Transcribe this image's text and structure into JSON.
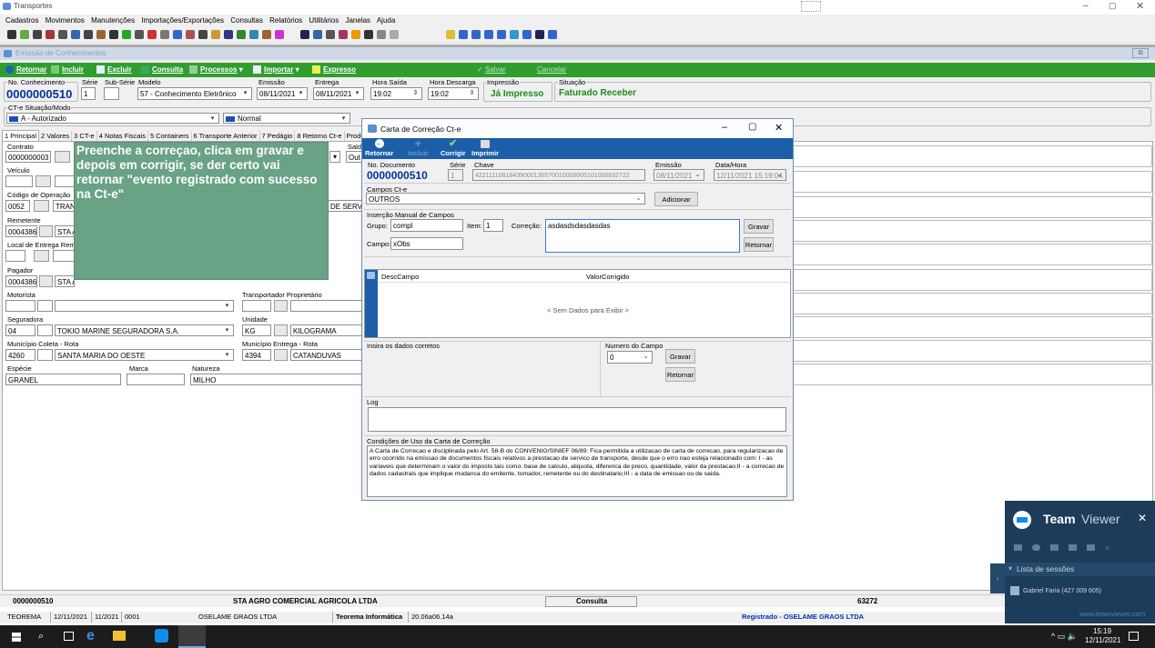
{
  "app": {
    "title": "Transportes"
  },
  "menu": [
    "Cadastros",
    "Movimentos",
    "Manutenções",
    "Importações/Exportações",
    "Consultas",
    "Relatórios",
    "Utilitários",
    "Janelas",
    "Ajuda"
  ],
  "mdi": {
    "title": "Emissão de Conhecimentos"
  },
  "actions": {
    "retornar": "Retornar",
    "incluir": "Incluir",
    "excluir": "Excluir",
    "consulta": "Consulta",
    "processos": "Processos",
    "importar": "Importar",
    "expresso": "Expresso",
    "salvar": "Salvar",
    "cancelar": "Cancelar"
  },
  "header": {
    "no_conhecimento_label": "No. Conhecimento",
    "no_conhecimento": "0000000510",
    "serie_label": "Série",
    "serie": "1",
    "subserie_label": "Sub-Série",
    "modelo_label": "Modelo",
    "modelo": "57 - Conhecimento Eletrônico",
    "emissao_label": "Emissão",
    "emissao": "08/11/2021",
    "entrega_label": "Entrega",
    "entrega": "08/11/2021",
    "hora_saida_label": "Hora Saída",
    "hora_saida": "19:02",
    "hora_descarga_label": "Hora Descarga",
    "hora_descarga": "19:02",
    "impressao_label": "Impressão",
    "impressao": "Já Impresso",
    "situacao_label": "Situação",
    "situacao": "Faturado Receber"
  },
  "situacao_modo": {
    "label": "CT-e Situação/Modo",
    "situacao": "A - Autorizado",
    "modo": "Normal"
  },
  "tabs": [
    "1 Principal",
    "2 Valores",
    "3 CT-e",
    "4 Notas Fiscais",
    "5 Containers",
    "6 Transporte Anterior",
    "7 Pedágio",
    "8 Retorno Ct-e",
    "Produt"
  ],
  "form": {
    "contrato_label": "Contrato",
    "contrato": "0000000003",
    "veiculo_label": "Veículo",
    "codigo_op_label": "Código de Operação",
    "codigo_op": "0052",
    "codigo_op_desc": "TRAN",
    "de_serv": "DE SERV",
    "saldo_label": "Sald",
    "saldo_value": "Out",
    "remetente_label": "Remetente",
    "remetente": "0004386",
    "remetente_nome": "STA A",
    "local_entrega_label": "Local de Entrega Rem",
    "pagador_label": "Pagador",
    "pagador": "0004386",
    "pagador_nome": "STA A",
    "motorista_label": "Motorista",
    "transp_label": "Transportador Proprietário",
    "seguradora_label": "Seguradora",
    "seguradora_cod": "04",
    "seguradora": "TOKIO MARINE SEGURADORA S.A.",
    "unidade_label": "Unidade",
    "unidade_cod": "KG",
    "unidade": "KILOGRAMA",
    "mun_coleta_label": "Município Coleta - Rota",
    "mun_coleta_cod": "4260",
    "mun_coleta": "SANTA MARIA DO OESTE",
    "mun_entrega_label": "Município Entrega - Rota",
    "mun_entrega_cod": "4394",
    "mun_entrega": "CATANDUVAS",
    "especie_label": "Espécie",
    "especie": "GRANEL",
    "marca_label": "Marca",
    "natureza_label": "Natureza",
    "natureza": "MILHO"
  },
  "note": "Preenche a correçao, clica em gravar e depois em corrigir, se der certo vai retornar \"evento registrado com sucesso na Ct-e\"",
  "dialog": {
    "title": "Carta de Correção Ct-e",
    "toolbar": {
      "retornar": "Retornar",
      "incluir": "Incluir",
      "corrigir": "Corrigir",
      "imprimir": "Imprimir"
    },
    "no_doc_label": "No. Documento",
    "no_doc": "0000000510",
    "serie_label": "Série",
    "serie": "1",
    "chave_label": "Chave",
    "chave": "42211110618439000136570010000005101000632722",
    "emissao_label": "Emissão",
    "emissao": "08/11/2021",
    "datahora_label": "Data/Hora",
    "datahora": "12/11/2021 15:19:04",
    "campos_label": "Campos Ct-e",
    "campos": "OUTROS",
    "adicionar": "Adicionar",
    "insercao_label": "Inserção Manual de Campos",
    "grupo_label": "Grupo:",
    "grupo": "compl",
    "item_label": "Item:",
    "item": "1",
    "correcao_label": "Correção:",
    "correcao": "asdasdsdasdasdas",
    "campo_label": "Campo:",
    "campo": "xObs",
    "gravar": "Gravar",
    "retornar_btn": "Retornar",
    "grid_col1": "DescCampo",
    "grid_col2": "ValorCorrigido",
    "grid_empty": "< Sem Dados para Exibir >",
    "insira_label": "Insira os dados corretos",
    "numero_campo_label": "Numero do Campo",
    "numero_campo": "0",
    "gravar2": "Gravar",
    "retornar2": "Retornar",
    "log_label": "Log",
    "condicoes_label": "Condições de Uso da Carta de Correção",
    "condicoes": "A Carta de Correcao e disciplinada pelo Art. 58-B do CONVENIO/SINIEF 06/89: Fica permitida a utilizacao de carta de correcao, para regularizacao de erro ocorrido na emissao de documentos fiscais relativos a prestacao de servico de transporte, desde que o erro nao esteja relacionado com: I - as variaveis que determinam o valor do imposto tais como: base de calculo, aliquota, diferenca de preco, quantidade, valor da prestacao;II - a correcao de dados cadastrais que implique mudanca do emitente, tomador, remetente ou do destinatario;III - a data de emissao ou de saida."
  },
  "footer": {
    "numero": "0000000510",
    "empresa": "STA AGRO COMERCIAL AGRICOLA LTDA",
    "modo": "Consulta",
    "codigo": "63272"
  },
  "status": {
    "sistema": "TEOREMA",
    "data": "12/11/2021",
    "periodo": "11/2021",
    "filial": "0001",
    "usuario": "OSELAME GRAOS LTDA",
    "fornecedor": "Teorema Informática",
    "versao": "20.06a06.14a",
    "registrado": "Registrado - OSELAME GRAOS LTDA"
  },
  "teamviewer": {
    "brand_team": "Team",
    "brand_viewer": "Viewer",
    "sessions_label": "Lista de sessões",
    "session": "Gabriel Faria (427 009 605)",
    "url": "www.teamviewer.com"
  },
  "taskbar": {
    "time": "15:19",
    "date": "12/11/2021"
  },
  "colors": {
    "green_bar": "#2f9e2f",
    "note_bg": "#6aa286",
    "blue": "#003399"
  }
}
